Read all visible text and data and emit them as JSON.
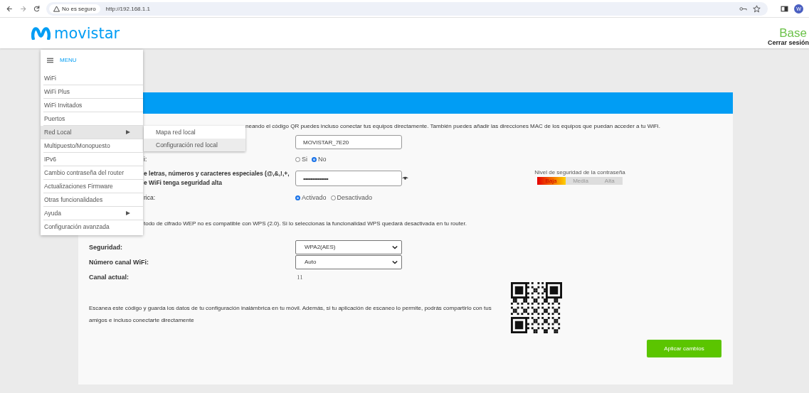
{
  "browser": {
    "security_label": "No es seguro",
    "url": "http://192.168.1.1",
    "profile_initial": "W"
  },
  "header": {
    "logo_text": "movistar",
    "plan": "Base",
    "logout": "Cerrar sesión"
  },
  "menu": {
    "title": "MENU",
    "items": [
      {
        "label": "WiFi",
        "selected": false,
        "has_submenu": false
      },
      {
        "label": "WiFi Plus",
        "selected": false,
        "has_submenu": false
      },
      {
        "label": "WiFi Invitados",
        "selected": false,
        "has_submenu": false
      },
      {
        "label": "Puertos",
        "selected": false,
        "has_submenu": false
      },
      {
        "label": "Red Local",
        "selected": true,
        "has_submenu": true,
        "submenu": [
          {
            "label": "Mapa red local",
            "selected": false
          },
          {
            "label": "Configuración red local",
            "selected": true
          }
        ]
      },
      {
        "label": "Multipuesto/Monopuesto",
        "selected": false,
        "has_submenu": false
      },
      {
        "label": "IPv6",
        "selected": false,
        "has_submenu": false
      },
      {
        "label": "Cambio contraseña del router",
        "selected": false,
        "has_submenu": false
      },
      {
        "label": "Actualizaciones Firmware",
        "selected": false,
        "has_submenu": false
      },
      {
        "label": "Otras funcionalidades",
        "selected": false,
        "has_submenu": false
      },
      {
        "label": "Ayuda",
        "selected": false,
        "has_submenu": true
      },
      {
        "label": "Configuración avanzada",
        "selected": false,
        "has_submenu": false
      }
    ]
  },
  "form": {
    "intro": "neando el código QR puedes incluso conectar tus equipos directamente. También puedes añadir las direcciones MAC de los equipos que puedan acceder a tu WiFi.",
    "rows": [
      {
        "kind": "text",
        "value": "MOVISTAR_7E20"
      },
      {
        "kind": "radio",
        "label": "i:",
        "options": [
          {
            "label": "Si",
            "selected": false
          },
          {
            "label": "No",
            "selected": true
          }
        ]
      },
      {
        "kind": "password",
        "label_lines": [
          "e letras, números y caracteres especiales (@,&,!,+,",
          "e WiFi tenga seguridad alta"
        ],
        "value": "••••••••••••••••••••••••",
        "strength": {
          "title": "Nivel de seguridad de la contraseña",
          "level": 0.33,
          "labels": [
            "Baja",
            "Media",
            "Alta"
          ]
        }
      },
      {
        "kind": "radio",
        "label": "rica:",
        "options": [
          {
            "label": "Activado",
            "selected": true
          },
          {
            "label": "Desactivado",
            "selected": false
          }
        ]
      }
    ],
    "note": "todo de cifrado WEP no es compatible con WPS (2.0). Si lo seleccionas la funcionalidad WPS quedará desactivada en tu router.",
    "settings": [
      {
        "kind": "select",
        "label": "Seguridad:",
        "value": "WPA2(AES)"
      },
      {
        "kind": "select",
        "label": "Número canal WiFi:",
        "value": "Auto"
      },
      {
        "kind": "static",
        "label": "Canal actual:",
        "value": "11"
      }
    ],
    "qr_text": "Escanea este código y guarda los datos de tu configuración inalámbrica en tu móvil. Además, si tu aplicación de escaneo lo permite, podrás compartirlo con tus amigos e incluso conectarte directamente",
    "apply_button": "Aplicar cambios"
  }
}
